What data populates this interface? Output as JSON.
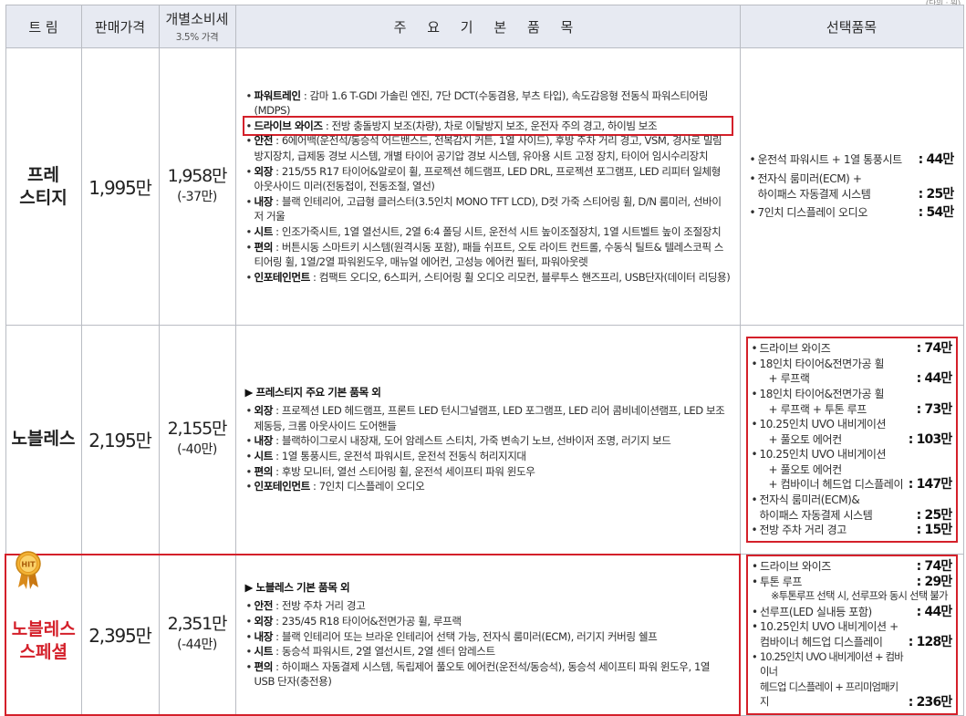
{
  "unit_note": "(단위 : 원)",
  "header": {
    "trim": "트 림",
    "price": "판매가격",
    "tax_price": "개별소비세",
    "tax_sub": "3.5% 가격",
    "basic": "주 요 기 본 품 목",
    "options": "선택품목"
  },
  "rows": [
    {
      "trim": "프레\n스티지",
      "price": "1,995만",
      "tax_price": "1,958만",
      "discount": "(-37만)",
      "basic": [
        {
          "label": "파워트레인",
          "text": " : 감마 1.6 T-GDI 가솔린 엔진, 7단 DCT(수동겸용, 부츠 타입), 속도감응형 전동식 파워스티어링(MDPS)"
        },
        {
          "label": "드라이브 와이즈",
          "text": " : 전방 충돌방지 보조(차량), 차로 이탈방지 보조, 운전자 주의 경고, 하이빔 보조"
        },
        {
          "label": "안전",
          "text": " : 6에어백(운전석/동승석 어드밴스드, 전복감지 커튼, 1열 사이드), 후방 주차 거리 경고, VSM, 경사로 밀림방지장치, 급제동 경보 시스템, 개별 타이어 공기압 경보 시스템, 유아용 시트 고정 장치, 타이어 임시수리장치"
        },
        {
          "label": "외장",
          "text": " : 215/55 R17 타이어&알로이 휠, 프로젝션 헤드램프, LED DRL, 프로젝션 포그램프, LED 리피터 일체형 아웃사이드 미러(전동접이, 전동조절, 열선)"
        },
        {
          "label": "내장",
          "text": " : 블랙 인테리어, 고급형 클러스터(3.5인치 MONO TFT LCD), D컷 가죽 스티어링 휠, D/N 룸미러, 선바이저 거울"
        },
        {
          "label": "시트",
          "text": " : 인조가죽시트, 1열 열선시트, 2열 6:4 폴딩 시트, 운전석 시트 높이조절장치, 1열 시트벨트 높이 조절장치"
        },
        {
          "label": "편의",
          "text": " : 버튼시동 스마트키 시스템(원격시동 포함), 패들 쉬프트, 오토 라이트 컨트롤, 수동식 틸트& 텔레스코픽 스티어링 휠, 1열/2열 파워윈도우, 매뉴얼 에어컨, 고성능 에어컨 필터, 파워아웃렛"
        },
        {
          "label": "인포테인먼트",
          "text": " : 컴팩트 오디오, 6스피커, 스티어링 휠 오디오 리모컨, 블루투스 핸즈프리, USB단자(데이터 리딩용)"
        }
      ],
      "options": [
        {
          "lines": [
            "운전석 파워시트 + 1열 통풍시트"
          ],
          "price": ": 44만"
        },
        {
          "lines": [
            "전자식 룸미러(ECM) +",
            "하이패스 자동결제 시스템"
          ],
          "price": ": 25만"
        },
        {
          "lines": [
            "7인치 디스플레이 오디오"
          ],
          "price": ": 54만"
        }
      ]
    },
    {
      "trim": "노블레스",
      "price": "2,195만",
      "tax_price": "2,155만",
      "discount": "(-40만)",
      "lead": "▶ 프레스티지 주요 기본 품목 외",
      "basic": [
        {
          "label": "외장",
          "text": " : 프로젝션 LED 헤드램프, 프론트 LED 턴시그널램프, LED 포그램프, LED 리어 콤비네이션램프, LED 보조제동등, 크롬 아웃사이드 도어핸들"
        },
        {
          "label": "내장",
          "text": " : 블랙하이그로시 내장재, 도어 암레스트 스티치, 가죽 변속기 노브, 선바이저 조명, 러기지 보드"
        },
        {
          "label": "시트",
          "text": " : 1열 통풍시트, 운전석 파워시트, 운전석 전동식 허리지지대"
        },
        {
          "label": "편의",
          "text": " : 후방 모니터, 열선 스티어링 휠, 운전석 세이프티 파워 윈도우"
        },
        {
          "label": "인포테인먼트",
          "text": " : 7인치 디스플레이 오디오"
        }
      ],
      "options": [
        {
          "lines": [
            "드라이브 와이즈"
          ],
          "price": ": 74만"
        },
        {
          "lines": [
            "18인치 타이어&전면가공 휠",
            "+ 루프랙"
          ],
          "price": ": 44만"
        },
        {
          "lines": [
            "18인치 타이어&전면가공 휠",
            "+ 루프랙 + 투톤 루프"
          ],
          "price": ": 73만"
        },
        {
          "lines": [
            "10.25인치 UVO 내비게이션",
            "+ 풀오토 에어컨"
          ],
          "price": ": 103만"
        },
        {
          "lines": [
            "10.25인치 UVO 내비게이션",
            "+ 풀오토 에어컨",
            "+ 컴바이너 헤드업 디스플레이"
          ],
          "price": ": 147만"
        },
        {
          "lines": [
            "전자식 룸미러(ECM)&",
            "하이패스 자동결제 시스템"
          ],
          "price": ": 25만"
        },
        {
          "lines": [
            "전방 주차 거리 경고"
          ],
          "price": ": 15만"
        }
      ]
    },
    {
      "trim": "노블레스\n스페셜",
      "badge": "HIT",
      "price": "2,395만",
      "tax_price": "2,351만",
      "discount": "(-44만)",
      "lead": "▶ 노블레스 기본 품목 외",
      "basic": [
        {
          "label": "안전",
          "text": " : 전방 주차 거리 경고"
        },
        {
          "label": "외장",
          "text": " : 235/45 R18 타이어&전면가공 휠, 루프랙"
        },
        {
          "label": "내장",
          "text": " : 블랙 인테리어 또는 브라운 인테리어 선택 가능, 전자식 룸미러(ECM), 러기지 커버링 쉘프"
        },
        {
          "label": "시트",
          "text": " : 동승석 파워시트, 2열 열선시트, 2열 센터 암레스트"
        },
        {
          "label": "편의",
          "text": " : 하이패스 자동결제 시스템, 독립제어 풀오토 에어컨(운전석/동승석), 동승석 세이프티 파워 윈도우, 1열 USB 단자(충전용)"
        }
      ],
      "options": [
        {
          "lines": [
            "드라이브 와이즈"
          ],
          "price": ": 74만"
        },
        {
          "lines": [
            "투톤 루프"
          ],
          "price": ": 29만",
          "note": "※투톤루프 선택 시, 선루프와 동시 선택 불가"
        },
        {
          "lines": [
            "선루프(LED 실내등 포함)"
          ],
          "price": ": 44만"
        },
        {
          "lines": [
            "10.25인치 UVO 내비게이션 +",
            "컴바이너 헤드업 디스플레이"
          ],
          "price": ": 128만"
        },
        {
          "lines": [
            "10.25인치 UVO 내비게이션 + 컴바이너",
            "헤드업 디스플레이 + 프리미엄패키지"
          ],
          "price": ": 236만"
        }
      ]
    }
  ],
  "colors": {
    "header_bg": "#e7eaf2",
    "highlight_red": "#d4202a",
    "grid": "#b9bcc3",
    "medal_gold": "#e8a020"
  }
}
